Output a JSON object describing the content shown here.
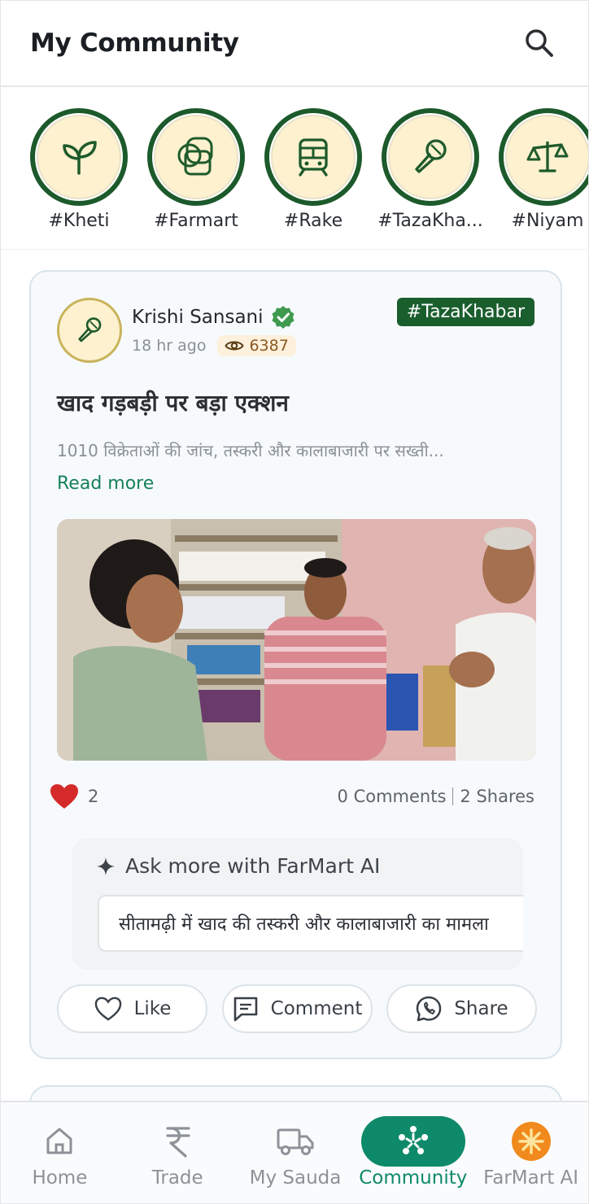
{
  "header": {
    "title": "My Community",
    "search_icon": "search-icon"
  },
  "stories": [
    {
      "label": "#Kheti",
      "icon": "leaf-icon"
    },
    {
      "label": "#Farmart",
      "icon": "farmart-logo-icon"
    },
    {
      "label": "#Rake",
      "icon": "train-icon"
    },
    {
      "label": "#TazaKha...",
      "icon": "microphone-icon"
    },
    {
      "label": "#Niyam",
      "icon": "scales-icon"
    }
  ],
  "post": {
    "author": "Krishi Sansani",
    "verified": true,
    "time": "18 hr ago",
    "views": "6387",
    "tag": "#TazaKhabar",
    "title": "खाद गड़बड़ी पर बड़ा एक्शन",
    "description": "1010 विक्रेताओं की जांच, तस्करी और कालाबाजारी पर सख्ती...",
    "read_more": "Read more",
    "likes": "2",
    "comments": "0 Comments",
    "shares": "2 Shares",
    "ask_title": "Ask more with FarMart AI",
    "ask_prompt": "सीतामढ़ी में खाद की तस्करी और कालाबाजारी का मामला",
    "actions": {
      "like": "Like",
      "comment": "Comment",
      "share": "Share"
    }
  },
  "bottom_nav": [
    {
      "label": "Home",
      "icon": "home-icon",
      "active": false
    },
    {
      "label": "Trade",
      "icon": "rupee-icon",
      "active": false
    },
    {
      "label": "My Sauda",
      "icon": "truck-icon",
      "active": false
    },
    {
      "label": "Community",
      "icon": "community-icon",
      "active": true
    },
    {
      "label": "FarMart AI",
      "icon": "farmart-ai-icon",
      "active": false
    }
  ],
  "colors": {
    "primary_green": "#1b5e2e",
    "accent_teal": "#0e8a6a",
    "heart_red": "#d42a2a"
  }
}
